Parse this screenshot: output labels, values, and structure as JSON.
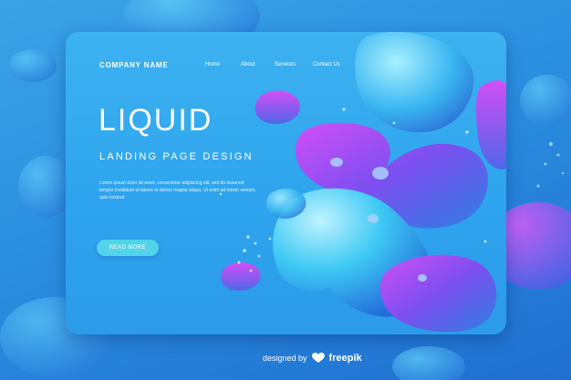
{
  "header": {
    "brand": "COMPANY NAME",
    "nav": [
      {
        "label": "Home"
      },
      {
        "label": "About"
      },
      {
        "label": "Services"
      },
      {
        "label": "Contact Us"
      }
    ]
  },
  "hero": {
    "title": "LIQUID",
    "subtitle": "LANDING PAGE DESIGN",
    "body": "Lorem ipsum dolor sit amet, consectetur adipiscing elit, sed do eiusmod tempor incididunt ut labore et dolore magna aliqua. Ut enim ad minim veniam, quis nostrud",
    "cta_label": "READ MORE"
  },
  "footer": {
    "designed_by": "designed by",
    "brand": "freepik"
  },
  "colors": {
    "accent_cta": "#51d4ea",
    "blob_magenta": "#b33cf2",
    "blob_cyan": "#36c8f3",
    "background": "#2b8fe0"
  },
  "icons": {
    "footer_logo": "freepik-logo-icon"
  }
}
